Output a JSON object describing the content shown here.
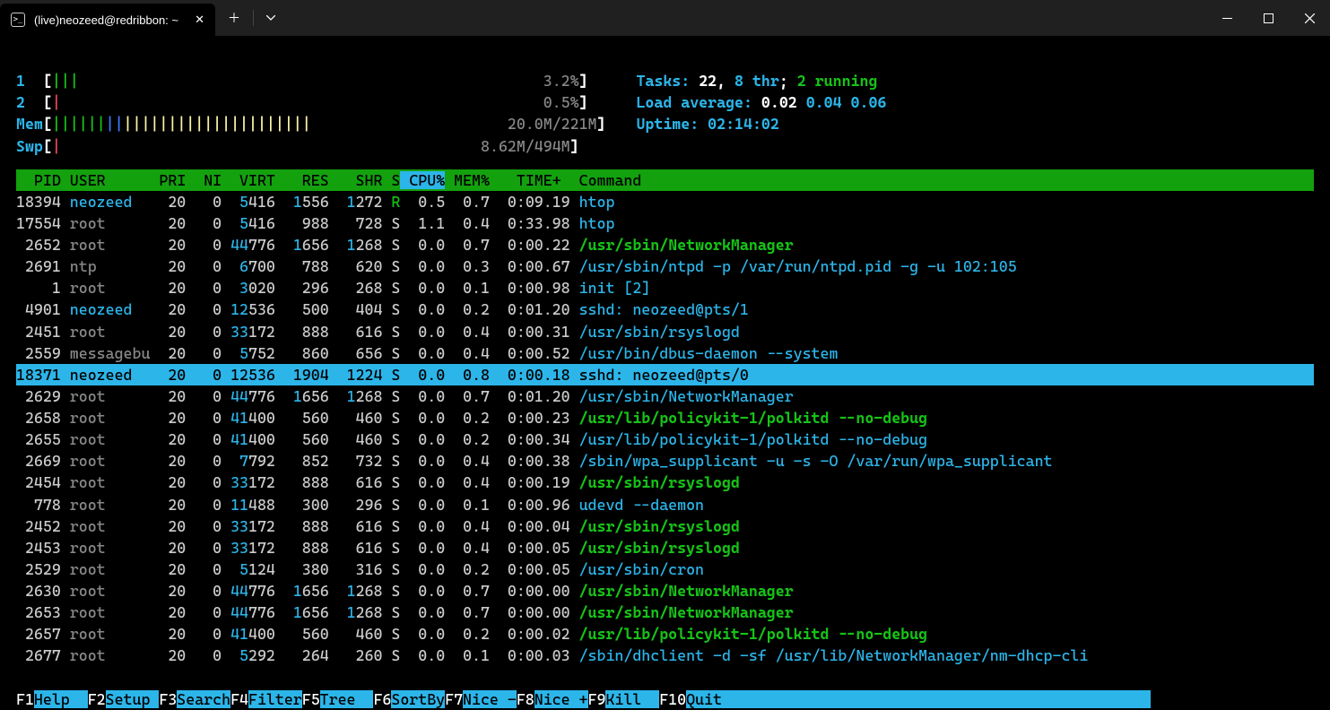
{
  "window": {
    "tab_title": "(live)neozeed@redribbon: ~"
  },
  "meters": {
    "cpu1_label": "1",
    "cpu1_pct": "3.2%",
    "cpu2_label": "2",
    "cpu2_pct": "0.5%",
    "mem_label": "Mem",
    "mem_val": "20.0M/221M",
    "swp_label": "Swp",
    "swp_val": "8.62M/494M"
  },
  "info": {
    "tasks_label": "Tasks: ",
    "tasks_count": "22",
    "tasks_sep": ", ",
    "thr": "8 thr",
    "sep2": "; ",
    "running": "2 running",
    "load_label": "Load average: ",
    "la1": "0.02",
    "la2": "0.04",
    "la3": "0.06",
    "uptime_label": "Uptime: ",
    "uptime_val": "02:14:02"
  },
  "headers": {
    "pid": "  PID",
    "user": "USER     ",
    "pri": " PRI",
    "ni": "  NI",
    "virt": "  VIRT",
    "res": "   RES",
    "shr": "   SHR",
    "s": "S",
    "cpu": " CPU%",
    "mem": " MEM%",
    "time": "   TIME+ ",
    "cmd": " Command"
  },
  "processes": [
    {
      "pid": "18394",
      "user": "neozeed",
      "usercol": "c-cyan",
      "pri": "20",
      "ni": "0",
      "virt_h": "5",
      "virt": "416",
      "res_h": "1",
      "res": "556",
      "shr_h": "1",
      "shr": "272",
      "s": "R",
      "scol": "c-green",
      "cpu": "0.5",
      "mem": "0.7",
      "time": "0:09.19",
      "cmd": "htop",
      "cmdcol": "c-cyan"
    },
    {
      "pid": "17554",
      "user": "root",
      "usercol": "c-grey",
      "pri": "20",
      "ni": "0",
      "virt_h": "5",
      "virt": "416",
      "res_h": "",
      "res": "988",
      "shr_h": "",
      "shr": "728",
      "s": "S",
      "scol": "",
      "cpu": "1.1",
      "mem": "0.4",
      "time": "0:33.98",
      "cmd": "htop",
      "cmdcol": "c-cyan"
    },
    {
      "pid": "2652",
      "user": "root",
      "usercol": "c-grey",
      "pri": "20",
      "ni": "0",
      "virt_h": "44",
      "virt": "776",
      "res_h": "1",
      "res": "656",
      "shr_h": "1",
      "shr": "268",
      "s": "S",
      "scol": "",
      "cpu": "0.0",
      "mem": "0.7",
      "time": "0:00.22",
      "cmd": "/usr/sbin/NetworkManager",
      "cmdcol": "c-bgreen"
    },
    {
      "pid": "2691",
      "user": "ntp",
      "usercol": "c-grey",
      "pri": "20",
      "ni": "0",
      "virt_h": "6",
      "virt": "700",
      "res_h": "",
      "res": "788",
      "shr_h": "",
      "shr": "620",
      "s": "S",
      "scol": "",
      "cpu": "0.0",
      "mem": "0.3",
      "time": "0:00.67",
      "cmd": "/usr/sbin/ntpd -p /var/run/ntpd.pid -g -u 102:105",
      "cmdcol": "c-cyan"
    },
    {
      "pid": "1",
      "user": "root",
      "usercol": "c-grey",
      "pri": "20",
      "ni": "0",
      "virt_h": "3",
      "virt": "020",
      "res_h": "",
      "res": "296",
      "shr_h": "",
      "shr": "268",
      "s": "S",
      "scol": "",
      "cpu": "0.0",
      "mem": "0.1",
      "time": "0:00.98",
      "cmd": "init [2]",
      "cmdcol": "c-cyan"
    },
    {
      "pid": "4901",
      "user": "neozeed",
      "usercol": "c-cyan",
      "pri": "20",
      "ni": "0",
      "virt_h": "12",
      "virt": "536",
      "res_h": "",
      "res": "500",
      "shr_h": "",
      "shr": "404",
      "s": "S",
      "scol": "",
      "cpu": "0.0",
      "mem": "0.2",
      "time": "0:01.20",
      "cmd": "sshd: neozeed@pts/1",
      "cmdcol": "c-cyan"
    },
    {
      "pid": "2451",
      "user": "root",
      "usercol": "c-grey",
      "pri": "20",
      "ni": "0",
      "virt_h": "33",
      "virt": "172",
      "res_h": "",
      "res": "888",
      "shr_h": "",
      "shr": "616",
      "s": "S",
      "scol": "",
      "cpu": "0.0",
      "mem": "0.4",
      "time": "0:00.31",
      "cmd": "/usr/sbin/rsyslogd",
      "cmdcol": "c-cyan"
    },
    {
      "pid": "2559",
      "user": "messagebu",
      "usercol": "c-grey",
      "pri": "20",
      "ni": "0",
      "virt_h": "5",
      "virt": "752",
      "res_h": "",
      "res": "860",
      "shr_h": "",
      "shr": "656",
      "s": "S",
      "scol": "",
      "cpu": "0.0",
      "mem": "0.4",
      "time": "0:00.52",
      "cmd": "/usr/bin/dbus-daemon --system",
      "cmdcol": "c-cyan"
    },
    {
      "pid": "18371",
      "user": "neozeed",
      "usercol": "",
      "pri": "20",
      "ni": "0",
      "virt_h": "12",
      "virt": "536",
      "res_h": "1",
      "res": "904",
      "shr_h": "1",
      "shr": "224",
      "s": "S",
      "scol": "",
      "cpu": "0.0",
      "mem": "0.8",
      "time": "0:00.18",
      "cmd": "sshd: neozeed@pts/0",
      "cmdcol": "",
      "selected": true
    },
    {
      "pid": "2629",
      "user": "root",
      "usercol": "c-grey",
      "pri": "20",
      "ni": "0",
      "virt_h": "44",
      "virt": "776",
      "res_h": "1",
      "res": "656",
      "shr_h": "1",
      "shr": "268",
      "s": "S",
      "scol": "",
      "cpu": "0.0",
      "mem": "0.7",
      "time": "0:01.20",
      "cmd": "/usr/sbin/NetworkManager",
      "cmdcol": "c-cyan"
    },
    {
      "pid": "2658",
      "user": "root",
      "usercol": "c-grey",
      "pri": "20",
      "ni": "0",
      "virt_h": "41",
      "virt": "400",
      "res_h": "",
      "res": "560",
      "shr_h": "",
      "shr": "460",
      "s": "S",
      "scol": "",
      "cpu": "0.0",
      "mem": "0.2",
      "time": "0:00.23",
      "cmd": "/usr/lib/policykit-1/polkitd --no-debug",
      "cmdcol": "c-bgreen"
    },
    {
      "pid": "2655",
      "user": "root",
      "usercol": "c-grey",
      "pri": "20",
      "ni": "0",
      "virt_h": "41",
      "virt": "400",
      "res_h": "",
      "res": "560",
      "shr_h": "",
      "shr": "460",
      "s": "S",
      "scol": "",
      "cpu": "0.0",
      "mem": "0.2",
      "time": "0:00.34",
      "cmd": "/usr/lib/policykit-1/polkitd --no-debug",
      "cmdcol": "c-cyan"
    },
    {
      "pid": "2669",
      "user": "root",
      "usercol": "c-grey",
      "pri": "20",
      "ni": "0",
      "virt_h": "7",
      "virt": "792",
      "res_h": "",
      "res": "852",
      "shr_h": "",
      "shr": "732",
      "s": "S",
      "scol": "",
      "cpu": "0.0",
      "mem": "0.4",
      "time": "0:00.38",
      "cmd": "/sbin/wpa_supplicant -u -s -O /var/run/wpa_supplicant",
      "cmdcol": "c-cyan"
    },
    {
      "pid": "2454",
      "user": "root",
      "usercol": "c-grey",
      "pri": "20",
      "ni": "0",
      "virt_h": "33",
      "virt": "172",
      "res_h": "",
      "res": "888",
      "shr_h": "",
      "shr": "616",
      "s": "S",
      "scol": "",
      "cpu": "0.0",
      "mem": "0.4",
      "time": "0:00.19",
      "cmd": "/usr/sbin/rsyslogd",
      "cmdcol": "c-bgreen"
    },
    {
      "pid": "778",
      "user": "root",
      "usercol": "c-grey",
      "pri": "20",
      "ni": "0",
      "virt_h": "11",
      "virt": "488",
      "res_h": "",
      "res": "300",
      "shr_h": "",
      "shr": "296",
      "s": "S",
      "scol": "",
      "cpu": "0.0",
      "mem": "0.1",
      "time": "0:00.96",
      "cmd": "udevd --daemon",
      "cmdcol": "c-cyan"
    },
    {
      "pid": "2452",
      "user": "root",
      "usercol": "c-grey",
      "pri": "20",
      "ni": "0",
      "virt_h": "33",
      "virt": "172",
      "res_h": "",
      "res": "888",
      "shr_h": "",
      "shr": "616",
      "s": "S",
      "scol": "",
      "cpu": "0.0",
      "mem": "0.4",
      "time": "0:00.04",
      "cmd": "/usr/sbin/rsyslogd",
      "cmdcol": "c-bgreen"
    },
    {
      "pid": "2453",
      "user": "root",
      "usercol": "c-grey",
      "pri": "20",
      "ni": "0",
      "virt_h": "33",
      "virt": "172",
      "res_h": "",
      "res": "888",
      "shr_h": "",
      "shr": "616",
      "s": "S",
      "scol": "",
      "cpu": "0.0",
      "mem": "0.4",
      "time": "0:00.05",
      "cmd": "/usr/sbin/rsyslogd",
      "cmdcol": "c-bgreen"
    },
    {
      "pid": "2529",
      "user": "root",
      "usercol": "c-grey",
      "pri": "20",
      "ni": "0",
      "virt_h": "5",
      "virt": "124",
      "res_h": "",
      "res": "380",
      "shr_h": "",
      "shr": "316",
      "s": "S",
      "scol": "",
      "cpu": "0.0",
      "mem": "0.2",
      "time": "0:00.05",
      "cmd": "/usr/sbin/cron",
      "cmdcol": "c-cyan"
    },
    {
      "pid": "2630",
      "user": "root",
      "usercol": "c-grey",
      "pri": "20",
      "ni": "0",
      "virt_h": "44",
      "virt": "776",
      "res_h": "1",
      "res": "656",
      "shr_h": "1",
      "shr": "268",
      "s": "S",
      "scol": "",
      "cpu": "0.0",
      "mem": "0.7",
      "time": "0:00.00",
      "cmd": "/usr/sbin/NetworkManager",
      "cmdcol": "c-bgreen"
    },
    {
      "pid": "2653",
      "user": "root",
      "usercol": "c-grey",
      "pri": "20",
      "ni": "0",
      "virt_h": "44",
      "virt": "776",
      "res_h": "1",
      "res": "656",
      "shr_h": "1",
      "shr": "268",
      "s": "S",
      "scol": "",
      "cpu": "0.0",
      "mem": "0.7",
      "time": "0:00.00",
      "cmd": "/usr/sbin/NetworkManager",
      "cmdcol": "c-bgreen"
    },
    {
      "pid": "2657",
      "user": "root",
      "usercol": "c-grey",
      "pri": "20",
      "ni": "0",
      "virt_h": "41",
      "virt": "400",
      "res_h": "",
      "res": "560",
      "shr_h": "",
      "shr": "460",
      "s": "S",
      "scol": "",
      "cpu": "0.0",
      "mem": "0.2",
      "time": "0:00.02",
      "cmd": "/usr/lib/policykit-1/polkitd --no-debug",
      "cmdcol": "c-bgreen"
    },
    {
      "pid": "2677",
      "user": "root",
      "usercol": "c-grey",
      "pri": "20",
      "ni": "0",
      "virt_h": "5",
      "virt": "292",
      "res_h": "",
      "res": "264",
      "shr_h": "",
      "shr": "260",
      "s": "S",
      "scol": "",
      "cpu": "0.0",
      "mem": "0.1",
      "time": "0:00.03",
      "cmd": "/sbin/dhclient -d -sf /usr/lib/NetworkManager/nm-dhcp-cli",
      "cmdcol": "c-cyan"
    }
  ],
  "footer": [
    {
      "k": "F1",
      "l": "Help  "
    },
    {
      "k": "F2",
      "l": "Setup "
    },
    {
      "k": "F3",
      "l": "Search"
    },
    {
      "k": "F4",
      "l": "Filter"
    },
    {
      "k": "F5",
      "l": "Tree  "
    },
    {
      "k": "F6",
      "l": "SortBy"
    },
    {
      "k": "F7",
      "l": "Nice -"
    },
    {
      "k": "F8",
      "l": "Nice +"
    },
    {
      "k": "F9",
      "l": "Kill  "
    },
    {
      "k": "F10",
      "l": "Quit                                                "
    }
  ]
}
